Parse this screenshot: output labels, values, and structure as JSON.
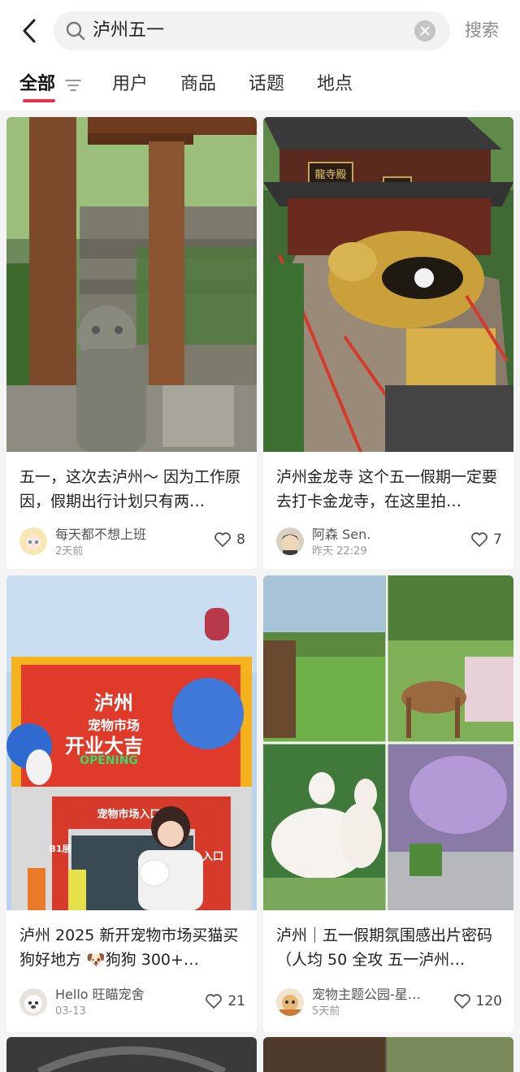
{
  "search": {
    "query": "泸州五一",
    "button_label": "搜索"
  },
  "tabs": [
    {
      "label": "全部"
    },
    {
      "label": "用户"
    },
    {
      "label": "商品"
    },
    {
      "label": "话题"
    },
    {
      "label": "地点"
    }
  ],
  "colors": {
    "accent": "#e8334a",
    "background": "#f4f4f4"
  },
  "posts": [
    {
      "title": "五一，这次去泸州～ 因为工作原因，假期出行计划只有两…",
      "author": "每天都不想上班",
      "time": "2天前",
      "likes": "8"
    },
    {
      "title": "泸州金龙寺 这个五一假期一定要去打卡金龙寺，在这里拍…",
      "author": "阿森 Sen.",
      "time": "昨天 22:29",
      "likes": "7",
      "sign_text": "龍寺殿"
    },
    {
      "title": "泸州 2025 新开宠物市场买猫买狗好地方 🐶狗狗 300+…",
      "author": "Hello 旺瞄宠舍",
      "time": "03-13",
      "likes": "21",
      "image_text": {
        "city": "泸州",
        "market": "宠物市场",
        "grand": "开业大吉",
        "opening": "OPENING",
        "entrance": "宠物市场入口B1",
        "b1": "B1层",
        "entry": "入口"
      }
    },
    {
      "title": "泸州｜五一假期氛围感出片密码（人均 50 全攻 五一泸州…",
      "author": "宠物主题公园-星…",
      "time": "5天前",
      "likes": "120"
    }
  ]
}
